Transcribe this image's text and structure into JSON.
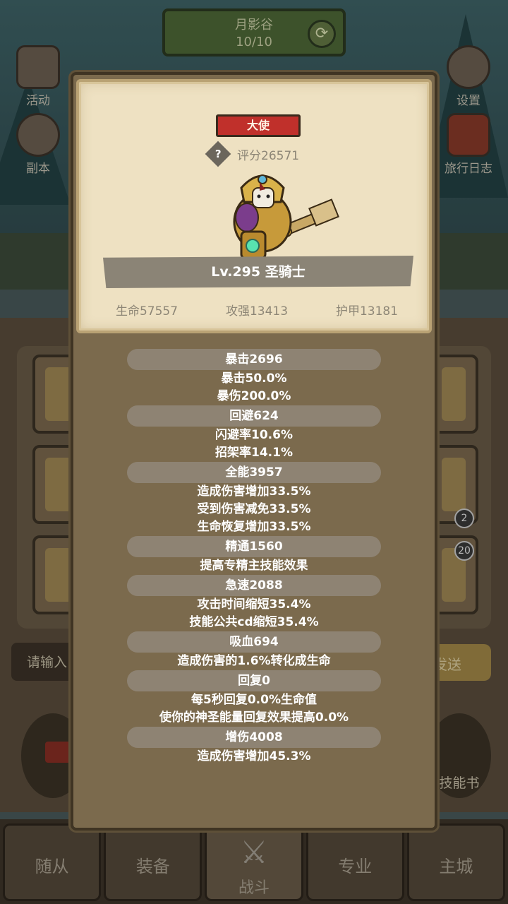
{
  "background": {
    "location_name": "月影谷",
    "location_progress": "10/10",
    "left_icons": [
      "活动",
      "副本"
    ],
    "right_icons": [
      "设置",
      "旅行日志"
    ],
    "input_placeholder": "请输入",
    "send_label": "发送",
    "skill_book_label": "技能书",
    "card_badges": [
      "2",
      "20"
    ],
    "nav": [
      "随从",
      "装备",
      "战斗",
      "专业",
      "主城"
    ]
  },
  "hero": {
    "rank": "大使",
    "score": "评分26571",
    "name": "Lv.295 圣骑士",
    "hp": "生命57557",
    "attack": "攻强13413",
    "armor": "护甲13181"
  },
  "stat_groups": [
    {
      "title": "暴击2696",
      "lines": [
        "暴击50.0%",
        "暴伤200.0%"
      ]
    },
    {
      "title": "回避624",
      "lines": [
        "闪避率10.6%",
        "招架率14.1%"
      ]
    },
    {
      "title": "全能3957",
      "lines": [
        "造成伤害增加33.5%",
        "受到伤害减免33.5%",
        "生命恢复增加33.5%"
      ]
    },
    {
      "title": "精通1560",
      "lines": [
        "提高专精主技能效果"
      ]
    },
    {
      "title": "急速2088",
      "lines": [
        "攻击时间缩短35.4%",
        "技能公共cd缩短35.4%"
      ]
    },
    {
      "title": "吸血694",
      "lines": [
        "造成伤害的1.6%转化成生命"
      ]
    },
    {
      "title": "回复0",
      "lines": [
        "每5秒回复0.0%生命值",
        "使你的神圣能量回复效果提高0.0%"
      ]
    },
    {
      "title": "增伤4008",
      "lines": [
        "造成伤害增加45.3%"
      ]
    }
  ],
  "colors": {
    "dialog_bg": "#7b6a4d",
    "card_bg": "#eee1c2",
    "rank_red": "#c0302b",
    "pill_bg": "#8e8373"
  }
}
